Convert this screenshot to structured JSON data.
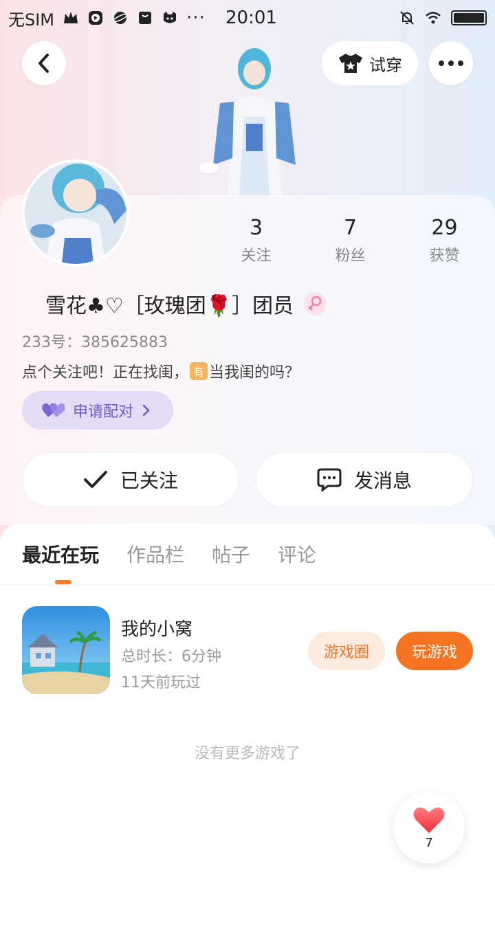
{
  "status_bar": {
    "carrier": "无SIM",
    "time": "20:01"
  },
  "header": {
    "try_on_label": "试穿"
  },
  "profile": {
    "stats": [
      {
        "value": "3",
        "label": "关注"
      },
      {
        "value": "7",
        "label": "粉丝"
      },
      {
        "value": "29",
        "label": "获赞"
      }
    ],
    "nickname": "雪花♣♡［玫瑰团🌹］团员",
    "uid": "233号：385625883",
    "bio_before": "点个关注吧！正在找闺，",
    "bio_emoji": "有",
    "bio_after": "当我闺的吗？",
    "pair_label": "申请配对"
  },
  "actions": {
    "follow_label": "已关注",
    "message_label": "发消息"
  },
  "tabs": [
    "最近在玩",
    "作品栏",
    "帖子",
    "评论"
  ],
  "game": {
    "name": "我的小窝",
    "duration": "总时长：6分钟",
    "last_played": "11天前玩过",
    "circle_label": "游戏圈",
    "play_label": "玩游戏"
  },
  "footer_note": "没有更多游戏了",
  "likes": {
    "count": "7"
  },
  "colors": {
    "accent": "#f57421",
    "pair_purple": "#6f5bc9"
  }
}
